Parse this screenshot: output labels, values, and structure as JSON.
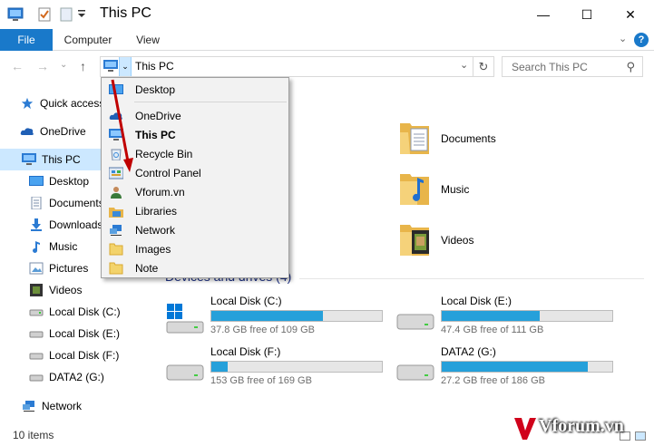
{
  "window": {
    "title": "This PC",
    "minimize": "—",
    "maximize": "☐",
    "close": "✕"
  },
  "ribbon": {
    "tabs": [
      "File",
      "Computer",
      "View"
    ],
    "expand": "⌄",
    "help": "?"
  },
  "nav": {
    "back": "←",
    "forward": "→",
    "recent": "⌄",
    "up": "↑",
    "address": "This PC",
    "address_dropdown": "⌄",
    "refresh": "↻",
    "search_placeholder": "Search This PC",
    "search_icon": "⚲"
  },
  "sidebar": {
    "items": [
      {
        "label": "Quick access",
        "icon": "star-icon"
      },
      {
        "label": "OneDrive",
        "icon": "cloud-icon"
      },
      {
        "label": "This PC",
        "icon": "computer-icon"
      },
      {
        "label": "Desktop",
        "icon": "desktop-icon"
      },
      {
        "label": "Documents",
        "icon": "documents-icon"
      },
      {
        "label": "Downloads",
        "icon": "downloads-icon"
      },
      {
        "label": "Music",
        "icon": "music-icon"
      },
      {
        "label": "Pictures",
        "icon": "pictures-icon"
      },
      {
        "label": "Videos",
        "icon": "videos-icon"
      },
      {
        "label": "Local Disk (C:)",
        "icon": "drive-icon"
      },
      {
        "label": "Local Disk (E:)",
        "icon": "drive-icon"
      },
      {
        "label": "Local Disk (F:)",
        "icon": "drive-icon"
      },
      {
        "label": "DATA2 (G:)",
        "icon": "drive-icon"
      },
      {
        "label": "Network",
        "icon": "network-icon"
      }
    ]
  },
  "folders": [
    {
      "label": "Documents",
      "icon": "documents-folder-icon"
    },
    {
      "label": "Music",
      "icon": "music-folder-icon"
    },
    {
      "label": "Videos",
      "icon": "videos-folder-icon"
    }
  ],
  "devices": {
    "header": "Devices and drives (4)",
    "drives": [
      {
        "name": "Local Disk (C:)",
        "free": "37.8 GB free of 109 GB",
        "used_fraction": 0.653
      },
      {
        "name": "Local Disk (E:)",
        "free": "47.4 GB free of 111 GB",
        "used_fraction": 0.573
      },
      {
        "name": "Local Disk (F:)",
        "free": "153 GB free of 169 GB",
        "used_fraction": 0.095
      },
      {
        "name": "DATA2 (G:)",
        "free": "27.2 GB free of 186 GB",
        "used_fraction": 0.854
      }
    ]
  },
  "status": {
    "items": "10 items"
  },
  "dropdown": {
    "items": [
      {
        "label": "Desktop",
        "icon": "desktop-icon"
      },
      {
        "label": "OneDrive",
        "icon": "cloud-icon"
      },
      {
        "label": "This PC",
        "icon": "computer-icon"
      },
      {
        "label": "Recycle Bin",
        "icon": "recycle-bin-icon"
      },
      {
        "label": "Control Panel",
        "icon": "control-panel-icon"
      },
      {
        "label": "Vforum.vn",
        "icon": "user-icon"
      },
      {
        "label": "Libraries",
        "icon": "libraries-icon"
      },
      {
        "label": "Network",
        "icon": "network-icon"
      },
      {
        "label": "Images",
        "icon": "folder-icon"
      },
      {
        "label": "Note",
        "icon": "folder-icon"
      }
    ]
  },
  "watermark": {
    "text": "Vforum.vn"
  },
  "colors": {
    "accent": "#1979ca",
    "selection": "#cce8ff",
    "drive_bar": "#26a0da",
    "annotation_arrow": "#c00000",
    "folder": "#f0c050"
  }
}
